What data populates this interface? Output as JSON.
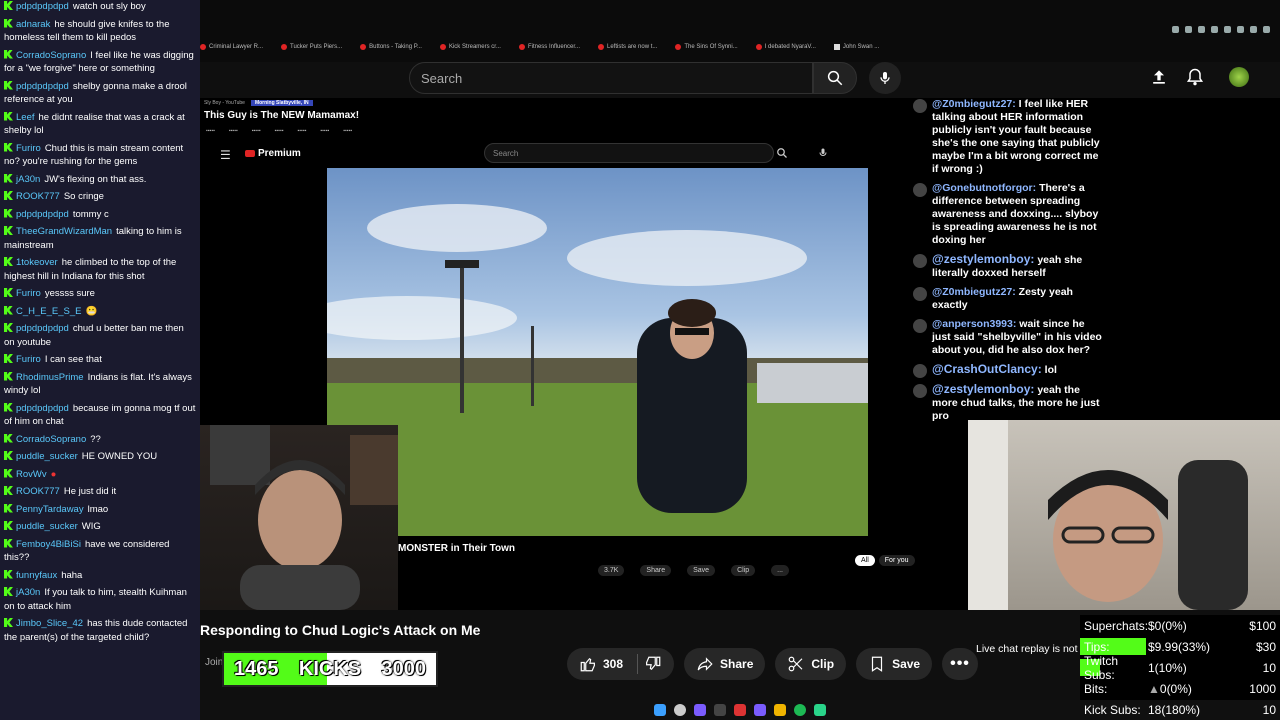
{
  "browser": {
    "tabs": [
      "Criminal Lawyer R...",
      "Tucker Puts Piers...",
      "Buttons - Taking P...",
      "Kick Streamers cr...",
      "Fitness Influencer...",
      "Leftists are now t...",
      "The Sins Of Synni...",
      "I debated NyaraV...",
      "John Swan ..."
    ]
  },
  "youtube": {
    "search_placeholder": "Search",
    "video_title": "Responding to Chud Logic's Attack on Me",
    "join_label": "Join",
    "like_count": "308",
    "share_label": "Share",
    "clip_label": "Clip",
    "save_label": "Save",
    "replay_text": "Live chat replay is not"
  },
  "inner": {
    "tab1": "Sly Boy - YouTube",
    "tab2": "Morning Slatbyville, IN",
    "title": "This Guy is The NEW Mamamax!",
    "logo": "Premium",
    "search": "Search",
    "video_title": "MONSTER in Their Town",
    "actions": [
      "3.7K",
      "Share",
      "Save",
      "Clip",
      "..."
    ],
    "chips": [
      "All",
      "For you"
    ],
    "chat": [
      {
        "name": "@Z0mbiegutz27:",
        "text": "I feel like HER talking about HER information publicly isn't your fault because she's the one saying that publicly maybe I'm a bit wrong correct me if wrong :)"
      },
      {
        "name": "@Gonebutnotforgor:",
        "text": "There's a difference between spreading awareness and doxxing.... slyboy is spreading awareness he is not doxing her"
      },
      {
        "name": "@zestylemonboy:",
        "text": "yeah she literally doxxed herself"
      },
      {
        "name": "@Z0mbiegutz27:",
        "text": "Zesty yeah exactly"
      },
      {
        "name": "@anperson3993:",
        "text": "wait since he just said \"shelbyville\" in his video about you, did he also dox her?"
      },
      {
        "name": "@CrashOutClancy:",
        "text": "lol"
      },
      {
        "name": "@zestylemonboy:",
        "text": "yeah the more chud talks, the more he just pro"
      }
    ]
  },
  "kicks": {
    "current": "1465",
    "label": "KICKS",
    "goal": "3000",
    "progress": 0.488
  },
  "stats": [
    {
      "label": "Superchats:",
      "value": "$0(0%)",
      "goal": "$100",
      "progress": 0
    },
    {
      "label": "Tips:",
      "value": "$9.99(33%)",
      "goal": "$30",
      "progress": 0.33
    },
    {
      "label": "Twitch Subs:",
      "value": "1(10%)",
      "goal": "10",
      "progress": 0.1
    },
    {
      "label": "Bits:",
      "value": "0(0%)",
      "goal": "1000",
      "progress": 0
    },
    {
      "label": "Kick Subs:",
      "value": "18(180%)",
      "goal": "10",
      "progress": 1
    }
  ],
  "chat": [
    {
      "user": "pdpdpdpdpd",
      "text": "watch out sly boy"
    },
    {
      "user": "adnarak",
      "text": "he should give knifes to the homeless tell them to kill pedos"
    },
    {
      "user": "CorradoSoprano",
      "text": "I feel like he was digging for a \"we forgive\" here or something"
    },
    {
      "user": "pdpdpdpdpd",
      "text": "shelby gonna make a drool reference at you"
    },
    {
      "user": "Leef",
      "text": "he didnt realise that was a crack at shelby lol"
    },
    {
      "user": "Furiro",
      "text": "Chud this is main stream content no? you're rushing for the gems"
    },
    {
      "user": "jA30n",
      "text": "JW's flexing on that ass."
    },
    {
      "user": "ROOK777",
      "text": "So cringe"
    },
    {
      "user": "pdpdpdpdpd",
      "text": "tommy c"
    },
    {
      "user": "TheeGrandWizardMan",
      "text": "talking to him is mainstream"
    },
    {
      "user": "1tokeover",
      "text": "he climbed to the top of the highest hill in Indiana for this shot"
    },
    {
      "user": "Furiro",
      "text": "yessss sure"
    },
    {
      "user": "C_H_E_E_S_E",
      "text": ""
    },
    {
      "user": "pdpdpdpdpd",
      "text": "chud u better ban me then on youtube"
    },
    {
      "user": "Furiro",
      "text": "I can see that"
    },
    {
      "user": "RhodimusPrime",
      "text": "Indians is flat. It's always windy lol"
    },
    {
      "user": "pdpdpdpdpd",
      "text": "because im gonna mog tf out of him on chat"
    },
    {
      "user": "CorradoSoprano",
      "text": "??"
    },
    {
      "user": "puddle_sucker",
      "text": "HE OWNED YOU"
    },
    {
      "user": "RovWv",
      "text": ""
    },
    {
      "user": "ROOK777",
      "text": "He just did it"
    },
    {
      "user": "PennyTardaway",
      "text": "lmao"
    },
    {
      "user": "puddle_sucker",
      "text": "WIG"
    },
    {
      "user": "Femboy4BiBiSi",
      "text": "have we considered this??"
    },
    {
      "user": "funnyfaux",
      "text": "haha"
    },
    {
      "user": "jA30n",
      "text": "If you talk to him, stealth Kuihman on to attack him"
    },
    {
      "user": "Jimbo_Slice_42",
      "text": "has this dude contacted the parent(s) of the targeted child?"
    }
  ]
}
